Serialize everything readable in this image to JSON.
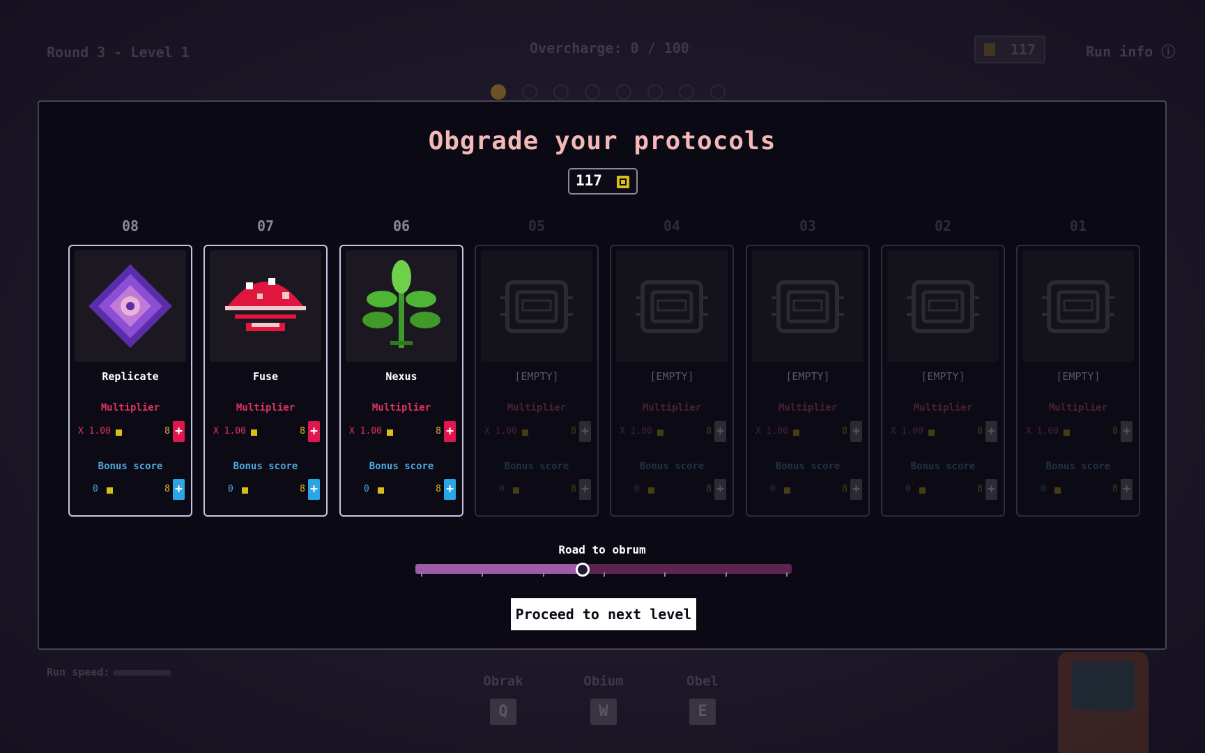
{
  "hud": {
    "round_label": "Round 3 - Level 1",
    "overcharge": "Overcharge: 0 / 100",
    "coins": "117",
    "run_info": "Run info",
    "run_speed": "Run speed:",
    "level_dots": 8,
    "current_dot": 1
  },
  "abilities": [
    {
      "name": "Obrak",
      "key": "Q"
    },
    {
      "name": "Obium",
      "key": "W"
    },
    {
      "name": "Obel",
      "key": "E"
    }
  ],
  "modal": {
    "title": "Obgrade your protocols",
    "balance": "117",
    "cards": [
      {
        "num": "08",
        "name": "Replicate",
        "empty": false,
        "icon": "crystal-flower-icon",
        "mult_label": "Multiplier",
        "mult_value": "X 1.00",
        "mult_cost": "8",
        "bonus_label": "Bonus score",
        "bonus_value": "0",
        "bonus_cost": "8"
      },
      {
        "num": "07",
        "name": "Fuse",
        "empty": false,
        "icon": "mushroom-icon",
        "mult_label": "Multiplier",
        "mult_value": "X 1.00",
        "mult_cost": "8",
        "bonus_label": "Bonus score",
        "bonus_value": "0",
        "bonus_cost": "8"
      },
      {
        "num": "06",
        "name": "Nexus",
        "empty": false,
        "icon": "leaf-plant-icon",
        "mult_label": "Multiplier",
        "mult_value": "X 1.00",
        "mult_cost": "8",
        "bonus_label": "Bonus score",
        "bonus_value": "0",
        "bonus_cost": "8"
      },
      {
        "num": "05",
        "name": "[EMPTY]",
        "empty": true,
        "icon": "chip-icon",
        "mult_label": "Multiplier",
        "mult_value": "X 1.00",
        "mult_cost": "8",
        "bonus_label": "Bonus score",
        "bonus_value": "0",
        "bonus_cost": "8"
      },
      {
        "num": "04",
        "name": "[EMPTY]",
        "empty": true,
        "icon": "chip-icon",
        "mult_label": "Multiplier",
        "mult_value": "X 1.00",
        "mult_cost": "8",
        "bonus_label": "Bonus score",
        "bonus_value": "0",
        "bonus_cost": "8"
      },
      {
        "num": "03",
        "name": "[EMPTY]",
        "empty": true,
        "icon": "chip-icon",
        "mult_label": "Multiplier",
        "mult_value": "X 1.00",
        "mult_cost": "8",
        "bonus_label": "Bonus score",
        "bonus_value": "0",
        "bonus_cost": "8"
      },
      {
        "num": "02",
        "name": "[EMPTY]",
        "empty": true,
        "icon": "chip-icon",
        "mult_label": "Multiplier",
        "mult_value": "X 1.00",
        "mult_cost": "8",
        "bonus_label": "Bonus score",
        "bonus_value": "0",
        "bonus_cost": "8"
      },
      {
        "num": "01",
        "name": "[EMPTY]",
        "empty": true,
        "icon": "chip-icon",
        "mult_label": "Multiplier",
        "mult_value": "X 1.00",
        "mult_cost": "8",
        "bonus_label": "Bonus score",
        "bonus_value": "0",
        "bonus_cost": "8"
      }
    ],
    "road_label": "Road to obrum",
    "road_progress": 0.44,
    "road_ticks": 7,
    "proceed_label": "Proceed to next level"
  },
  "colors": {
    "multiplier": "#e0164f",
    "bonus": "#2aa5e8",
    "coin": "#d8c017",
    "title": "#f3b8b8"
  }
}
